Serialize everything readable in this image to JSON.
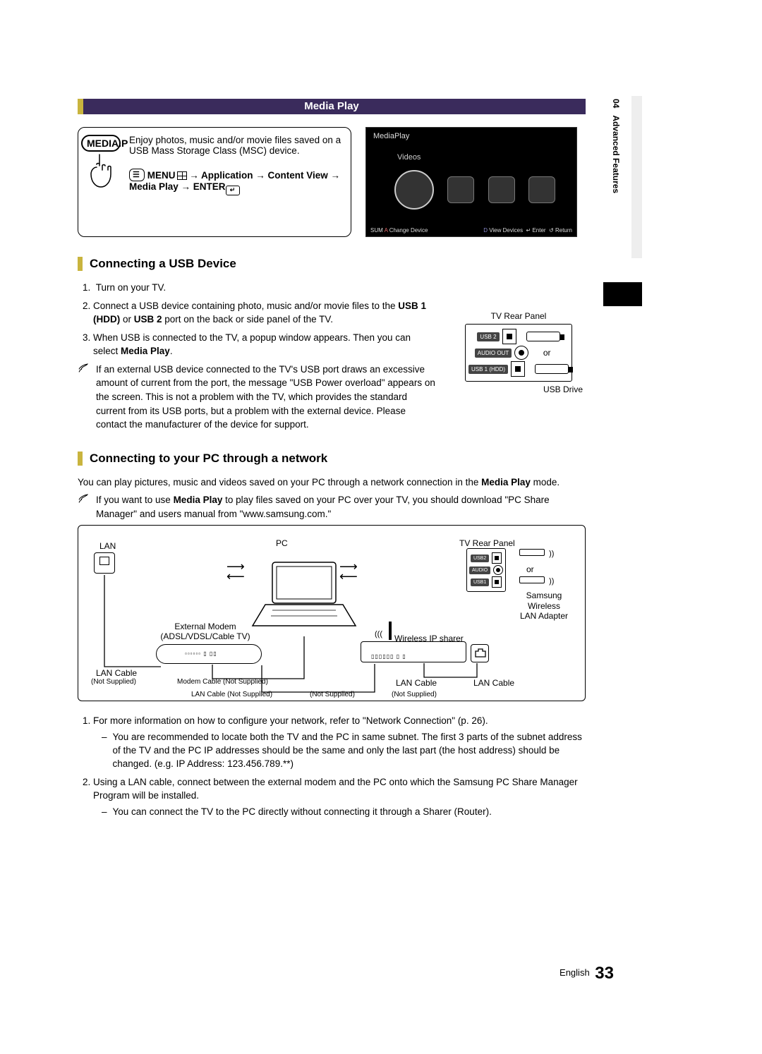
{
  "sidebar": {
    "chapter": "04",
    "title": "Advanced Features"
  },
  "header": {
    "title": "Media Play"
  },
  "intro": {
    "button_label": "MEDIA.P",
    "desc": "Enjoy photos, music and/or movie files saved on a USB Mass Storage Class (MSC) device.",
    "nav_pre": "MENU",
    "nav_path": " → Application → Content View → Media Play → ENTER",
    "nav_enter_glyph": "↵"
  },
  "screenshot": {
    "title": "MediaPlay",
    "videos": "Videos",
    "footer_left_sum": "SUM",
    "footer_left_change": " Change Device",
    "footer_view": "View Devices",
    "footer_enter": "Enter",
    "footer_return": "Return",
    "footer_view_key": "D",
    "footer_enter_key": "↵",
    "footer_return_key": "↺"
  },
  "sections": {
    "usb_title": "Connecting a USB Device",
    "pc_title": "Connecting to your PC through a network"
  },
  "usb_panel": {
    "caption_top": "TV Rear Panel",
    "usb2": "USB 2",
    "audio": "AUDIO OUT",
    "usb1": "USB 1 (HDD)",
    "or": "or",
    "usb_drive": "USB Drive"
  },
  "usb_steps": {
    "s1": "Turn on your TV.",
    "s2_pre": "Connect a USB device containing photo, music and/or movie files to the ",
    "s2_b1": "USB 1 (HDD)",
    "s2_mid": " or ",
    "s2_b2": "USB 2",
    "s2_post": " port on the back or side panel of the TV.",
    "s3_pre": "When USB is connected to the TV, a popup window appears. Then you can select ",
    "s3_b": "Media Play",
    "s3_post": "."
  },
  "usb_note": "If an external USB device connected to the TV's USB port draws an excessive amount of current from the port, the message \"USB Power overload\" appears on the screen. This is not a problem with the TV, which provides the standard current from its USB ports, but a problem with the external device. Please contact the manufacturer of the device for support.",
  "pc_intro_pre": "You can play pictures, music and videos saved on your PC through a network connection in the ",
  "pc_intro_b": "Media Play",
  "pc_intro_post": " mode.",
  "pc_note_pre": "If you want to use ",
  "pc_note_b": "Media Play",
  "pc_note_post": " to play files saved on your PC over your TV, you should download \"PC Share Manager\" and users manual from \"www.samsung.com.\"",
  "diagram": {
    "lan": "LAN",
    "pc": "PC",
    "rear": "TV Rear Panel",
    "or": "or",
    "wlan": "Samsung Wireless LAN Adapter",
    "ext_modem": "External Modem",
    "ext_modem_sub": "(ADSL/VDSL/Cable TV)",
    "wip": "Wireless IP sharer",
    "lan_cable": "LAN Cable",
    "not_supplied": "(Not Supplied)",
    "modem_cable": "Modem Cable (Not Supplied)",
    "lan_cable_ns": "LAN Cable (Not Supplied)"
  },
  "net_steps": {
    "s1": "For more information on how to configure your network, refer to \"Network Connection\" (p. 26).",
    "s1a": "You are recommended to locate both the TV and the PC in same subnet. The first 3 parts of the subnet address of the TV and the PC IP addresses should be the same and only the last part (the host address) should be changed. (e.g. IP Address: 123.456.789.**)",
    "s2": "Using a LAN cable, connect between the external modem and the PC onto which the Samsung PC Share Manager Program will be installed.",
    "s2a": "You can connect the TV to the PC directly without connecting it through a Sharer (Router)."
  },
  "footer": {
    "lang": "English",
    "page": "33"
  }
}
